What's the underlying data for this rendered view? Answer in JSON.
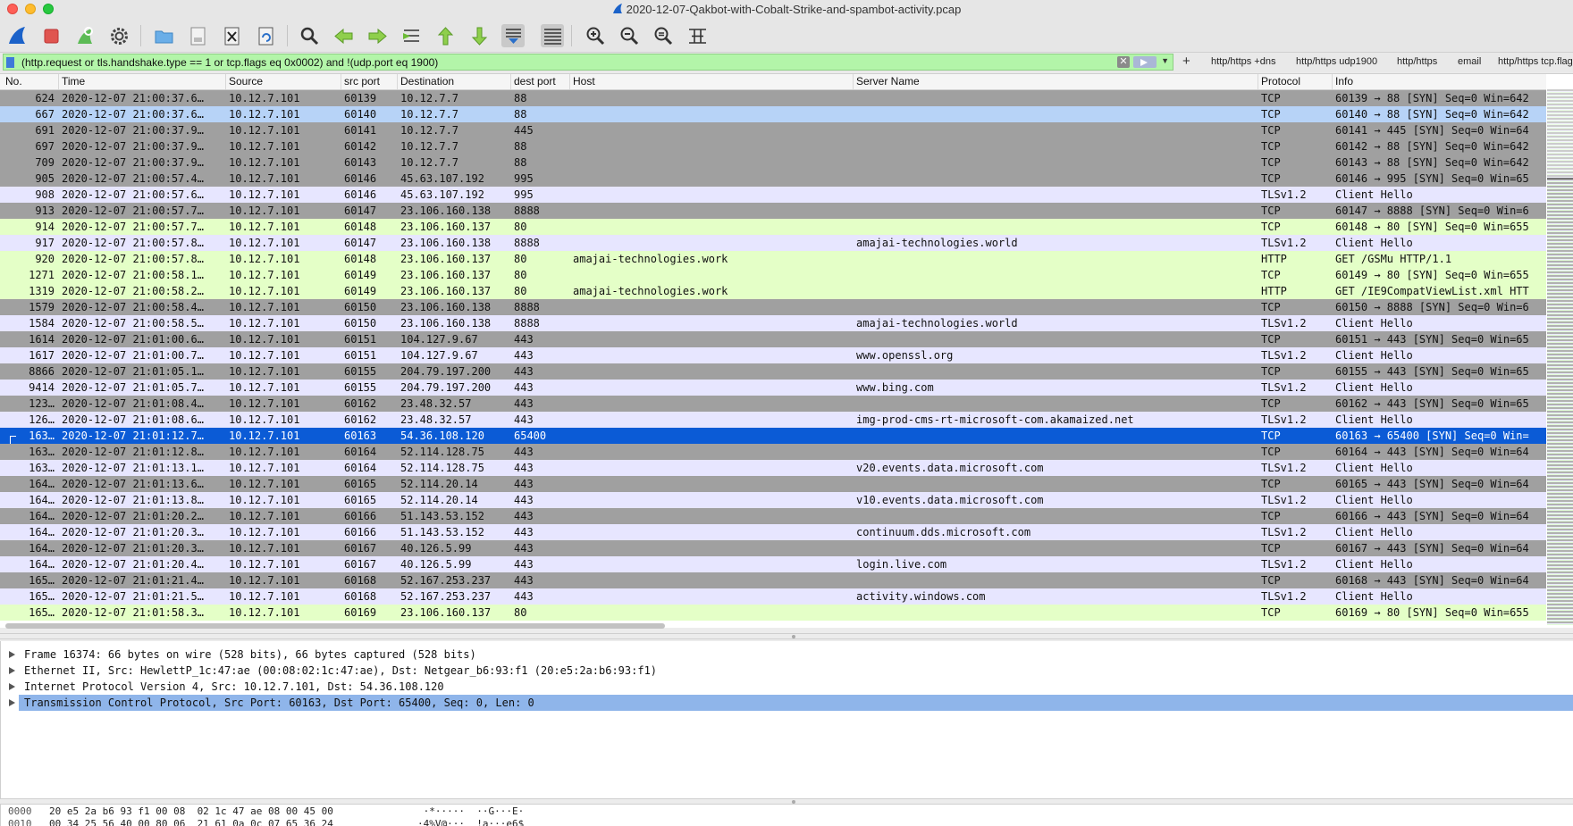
{
  "window": {
    "title": "2020-12-07-Qakbot-with-Cobalt-Strike-and-spambot-activity.pcap"
  },
  "toolbar": {
    "buttons": [
      {
        "icon": "shark-fin-start-icon"
      },
      {
        "icon": "stop-capture-icon"
      },
      {
        "icon": "restart-capture-icon"
      },
      {
        "icon": "capture-options-gear-icon"
      },
      {
        "icon": "open-folder-icon"
      },
      {
        "icon": "save-file-icon"
      },
      {
        "icon": "close-file-icon"
      },
      {
        "icon": "reload-file-icon"
      },
      {
        "icon": "find-packet-icon"
      },
      {
        "icon": "go-back-icon"
      },
      {
        "icon": "go-forward-icon"
      },
      {
        "icon": "go-to-packet-icon"
      },
      {
        "icon": "first-packet-icon"
      },
      {
        "icon": "last-packet-icon"
      },
      {
        "icon": "autoscroll-icon"
      },
      {
        "icon": "colorize-icon"
      },
      {
        "icon": "zoom-in-icon"
      },
      {
        "icon": "zoom-out-icon"
      },
      {
        "icon": "zoom-normal-icon"
      },
      {
        "icon": "resize-columns-icon"
      }
    ]
  },
  "filter": {
    "expression": "(http.request or tls.handshake.type == 1 or tcp.flags eq 0x0002) and !(udp.port eq 1900)",
    "clear_glyph": "✕",
    "dropdown_glyph": "▼",
    "add_label": "+",
    "buttons": [
      "http/https +dns",
      "http/https udp1900",
      "http/https",
      "email",
      "http/https tcp.flags"
    ]
  },
  "columns": [
    "No.",
    "Time",
    "Source",
    "src port",
    "Destination",
    "dest port",
    "Host",
    "Server Name",
    "Protocol",
    "Info"
  ],
  "packets": [
    {
      "no": "624",
      "time": "2020-12-07 21:00:37.6…",
      "src": "10.12.7.101",
      "sport": "60139",
      "dst": "10.12.7.7",
      "dport": "88",
      "host": "",
      "sni": "",
      "proto": "TCP",
      "info": "60139 → 88 [SYN] Seq=0 Win=642",
      "style": "syn"
    },
    {
      "no": "667",
      "time": "2020-12-07 21:00:37.6…",
      "src": "10.12.7.101",
      "sport": "60140",
      "dst": "10.12.7.7",
      "dport": "88",
      "host": "",
      "sni": "",
      "proto": "TCP",
      "info": "60140 → 88 [SYN] Seq=0 Win=642",
      "style": "blue"
    },
    {
      "no": "691",
      "time": "2020-12-07 21:00:37.9…",
      "src": "10.12.7.101",
      "sport": "60141",
      "dst": "10.12.7.7",
      "dport": "445",
      "host": "",
      "sni": "",
      "proto": "TCP",
      "info": "60141 → 445 [SYN] Seq=0 Win=64",
      "style": "syn"
    },
    {
      "no": "697",
      "time": "2020-12-07 21:00:37.9…",
      "src": "10.12.7.101",
      "sport": "60142",
      "dst": "10.12.7.7",
      "dport": "88",
      "host": "",
      "sni": "",
      "proto": "TCP",
      "info": "60142 → 88 [SYN] Seq=0 Win=642",
      "style": "syn"
    },
    {
      "no": "709",
      "time": "2020-12-07 21:00:37.9…",
      "src": "10.12.7.101",
      "sport": "60143",
      "dst": "10.12.7.7",
      "dport": "88",
      "host": "",
      "sni": "",
      "proto": "TCP",
      "info": "60143 → 88 [SYN] Seq=0 Win=642",
      "style": "syn"
    },
    {
      "no": "905",
      "time": "2020-12-07 21:00:57.4…",
      "src": "10.12.7.101",
      "sport": "60146",
      "dst": "45.63.107.192",
      "dport": "995",
      "host": "",
      "sni": "",
      "proto": "TCP",
      "info": "60146 → 995 [SYN] Seq=0 Win=65",
      "style": "syn"
    },
    {
      "no": "908",
      "time": "2020-12-07 21:00:57.6…",
      "src": "10.12.7.101",
      "sport": "60146",
      "dst": "45.63.107.192",
      "dport": "995",
      "host": "",
      "sni": "",
      "proto": "TLSv1.2",
      "info": "Client Hello",
      "style": "tls"
    },
    {
      "no": "913",
      "time": "2020-12-07 21:00:57.7…",
      "src": "10.12.7.101",
      "sport": "60147",
      "dst": "23.106.160.138",
      "dport": "8888",
      "host": "",
      "sni": "",
      "proto": "TCP",
      "info": "60147 → 8888 [SYN] Seq=0 Win=6",
      "style": "syn"
    },
    {
      "no": "914",
      "time": "2020-12-07 21:00:57.7…",
      "src": "10.12.7.101",
      "sport": "60148",
      "dst": "23.106.160.137",
      "dport": "80",
      "host": "",
      "sni": "",
      "proto": "TCP",
      "info": "60148 → 80 [SYN] Seq=0 Win=655",
      "style": "http"
    },
    {
      "no": "917",
      "time": "2020-12-07 21:00:57.8…",
      "src": "10.12.7.101",
      "sport": "60147",
      "dst": "23.106.160.138",
      "dport": "8888",
      "host": "",
      "sni": "amajai-technologies.world",
      "proto": "TLSv1.2",
      "info": "Client Hello",
      "style": "tls"
    },
    {
      "no": "920",
      "time": "2020-12-07 21:00:57.8…",
      "src": "10.12.7.101",
      "sport": "60148",
      "dst": "23.106.160.137",
      "dport": "80",
      "host": "amajai-technologies.work",
      "sni": "",
      "proto": "HTTP",
      "info": "GET /GSMu HTTP/1.1",
      "style": "http"
    },
    {
      "no": "1271",
      "time": "2020-12-07 21:00:58.1…",
      "src": "10.12.7.101",
      "sport": "60149",
      "dst": "23.106.160.137",
      "dport": "80",
      "host": "",
      "sni": "",
      "proto": "TCP",
      "info": "60149 → 80 [SYN] Seq=0 Win=655",
      "style": "http"
    },
    {
      "no": "1319",
      "time": "2020-12-07 21:00:58.2…",
      "src": "10.12.7.101",
      "sport": "60149",
      "dst": "23.106.160.137",
      "dport": "80",
      "host": "amajai-technologies.work",
      "sni": "",
      "proto": "HTTP",
      "info": "GET /IE9CompatViewList.xml HTT",
      "style": "http"
    },
    {
      "no": "1579",
      "time": "2020-12-07 21:00:58.4…",
      "src": "10.12.7.101",
      "sport": "60150",
      "dst": "23.106.160.138",
      "dport": "8888",
      "host": "",
      "sni": "",
      "proto": "TCP",
      "info": "60150 → 8888 [SYN] Seq=0 Win=6",
      "style": "syn"
    },
    {
      "no": "1584",
      "time": "2020-12-07 21:00:58.5…",
      "src": "10.12.7.101",
      "sport": "60150",
      "dst": "23.106.160.138",
      "dport": "8888",
      "host": "",
      "sni": "amajai-technologies.world",
      "proto": "TLSv1.2",
      "info": "Client Hello",
      "style": "tls"
    },
    {
      "no": "1614",
      "time": "2020-12-07 21:01:00.6…",
      "src": "10.12.7.101",
      "sport": "60151",
      "dst": "104.127.9.67",
      "dport": "443",
      "host": "",
      "sni": "",
      "proto": "TCP",
      "info": "60151 → 443 [SYN] Seq=0 Win=65",
      "style": "syn"
    },
    {
      "no": "1617",
      "time": "2020-12-07 21:01:00.7…",
      "src": "10.12.7.101",
      "sport": "60151",
      "dst": "104.127.9.67",
      "dport": "443",
      "host": "",
      "sni": "www.openssl.org",
      "proto": "TLSv1.2",
      "info": "Client Hello",
      "style": "tls"
    },
    {
      "no": "8866",
      "time": "2020-12-07 21:01:05.1…",
      "src": "10.12.7.101",
      "sport": "60155",
      "dst": "204.79.197.200",
      "dport": "443",
      "host": "",
      "sni": "",
      "proto": "TCP",
      "info": "60155 → 443 [SYN] Seq=0 Win=65",
      "style": "syn"
    },
    {
      "no": "9414",
      "time": "2020-12-07 21:01:05.7…",
      "src": "10.12.7.101",
      "sport": "60155",
      "dst": "204.79.197.200",
      "dport": "443",
      "host": "",
      "sni": "www.bing.com",
      "proto": "TLSv1.2",
      "info": "Client Hello",
      "style": "tls"
    },
    {
      "no": "123…",
      "time": "2020-12-07 21:01:08.4…",
      "src": "10.12.7.101",
      "sport": "60162",
      "dst": "23.48.32.57",
      "dport": "443",
      "host": "",
      "sni": "",
      "proto": "TCP",
      "info": "60162 → 443 [SYN] Seq=0 Win=65",
      "style": "syn"
    },
    {
      "no": "126…",
      "time": "2020-12-07 21:01:08.6…",
      "src": "10.12.7.101",
      "sport": "60162",
      "dst": "23.48.32.57",
      "dport": "443",
      "host": "",
      "sni": "img-prod-cms-rt-microsoft-com.akamaized.net",
      "proto": "TLSv1.2",
      "info": "Client Hello",
      "style": "tls"
    },
    {
      "no": "163…",
      "time": "2020-12-07 21:01:12.7…",
      "src": "10.12.7.101",
      "sport": "60163",
      "dst": "54.36.108.120",
      "dport": "65400",
      "host": "",
      "sni": "",
      "proto": "TCP",
      "info": "60163 → 65400 [SYN] Seq=0 Win=",
      "style": "selected"
    },
    {
      "no": "163…",
      "time": "2020-12-07 21:01:12.8…",
      "src": "10.12.7.101",
      "sport": "60164",
      "dst": "52.114.128.75",
      "dport": "443",
      "host": "",
      "sni": "",
      "proto": "TCP",
      "info": "60164 → 443 [SYN] Seq=0 Win=64",
      "style": "syn"
    },
    {
      "no": "163…",
      "time": "2020-12-07 21:01:13.1…",
      "src": "10.12.7.101",
      "sport": "60164",
      "dst": "52.114.128.75",
      "dport": "443",
      "host": "",
      "sni": "v20.events.data.microsoft.com",
      "proto": "TLSv1.2",
      "info": "Client Hello",
      "style": "tls"
    },
    {
      "no": "164…",
      "time": "2020-12-07 21:01:13.6…",
      "src": "10.12.7.101",
      "sport": "60165",
      "dst": "52.114.20.14",
      "dport": "443",
      "host": "",
      "sni": "",
      "proto": "TCP",
      "info": "60165 → 443 [SYN] Seq=0 Win=64",
      "style": "syn"
    },
    {
      "no": "164…",
      "time": "2020-12-07 21:01:13.8…",
      "src": "10.12.7.101",
      "sport": "60165",
      "dst": "52.114.20.14",
      "dport": "443",
      "host": "",
      "sni": "v10.events.data.microsoft.com",
      "proto": "TLSv1.2",
      "info": "Client Hello",
      "style": "tls"
    },
    {
      "no": "164…",
      "time": "2020-12-07 21:01:20.2…",
      "src": "10.12.7.101",
      "sport": "60166",
      "dst": "51.143.53.152",
      "dport": "443",
      "host": "",
      "sni": "",
      "proto": "TCP",
      "info": "60166 → 443 [SYN] Seq=0 Win=64",
      "style": "syn"
    },
    {
      "no": "164…",
      "time": "2020-12-07 21:01:20.3…",
      "src": "10.12.7.101",
      "sport": "60166",
      "dst": "51.143.53.152",
      "dport": "443",
      "host": "",
      "sni": "continuum.dds.microsoft.com",
      "proto": "TLSv1.2",
      "info": "Client Hello",
      "style": "tls"
    },
    {
      "no": "164…",
      "time": "2020-12-07 21:01:20.3…",
      "src": "10.12.7.101",
      "sport": "60167",
      "dst": "40.126.5.99",
      "dport": "443",
      "host": "",
      "sni": "",
      "proto": "TCP",
      "info": "60167 → 443 [SYN] Seq=0 Win=64",
      "style": "syn"
    },
    {
      "no": "164…",
      "time": "2020-12-07 21:01:20.4…",
      "src": "10.12.7.101",
      "sport": "60167",
      "dst": "40.126.5.99",
      "dport": "443",
      "host": "",
      "sni": "login.live.com",
      "proto": "TLSv1.2",
      "info": "Client Hello",
      "style": "tls"
    },
    {
      "no": "165…",
      "time": "2020-12-07 21:01:21.4…",
      "src": "10.12.7.101",
      "sport": "60168",
      "dst": "52.167.253.237",
      "dport": "443",
      "host": "",
      "sni": "",
      "proto": "TCP",
      "info": "60168 → 443 [SYN] Seq=0 Win=64",
      "style": "syn"
    },
    {
      "no": "165…",
      "time": "2020-12-07 21:01:21.5…",
      "src": "10.12.7.101",
      "sport": "60168",
      "dst": "52.167.253.237",
      "dport": "443",
      "host": "",
      "sni": "activity.windows.com",
      "proto": "TLSv1.2",
      "info": "Client Hello",
      "style": "tls"
    },
    {
      "no": "165…",
      "time": "2020-12-07 21:01:58.3…",
      "src": "10.12.7.101",
      "sport": "60169",
      "dst": "23.106.160.137",
      "dport": "80",
      "host": "",
      "sni": "",
      "proto": "TCP",
      "info": "60169 → 80 [SYN] Seq=0 Win=655",
      "style": "http"
    }
  ],
  "row_colors": {
    "syn": {
      "bg": "#a0a0a0",
      "fg": "#111111"
    },
    "tls": {
      "bg": "#e7e6ff",
      "fg": "#111111"
    },
    "http": {
      "bg": "#e4ffc7",
      "fg": "#111111"
    },
    "blue": {
      "bg": "#b7d3f7",
      "fg": "#111111"
    },
    "selected": {
      "bg": "#0b5bd6",
      "fg": "#ffffff"
    }
  },
  "details": [
    {
      "text": "Frame 16374: 66 bytes on wire (528 bits), 66 bytes captured (528 bits)",
      "selected": false
    },
    {
      "text": "Ethernet II, Src: HewlettP_1c:47:ae (00:08:02:1c:47:ae), Dst: Netgear_b6:93:f1 (20:e5:2a:b6:93:f1)",
      "selected": false
    },
    {
      "text": "Internet Protocol Version 4, Src: 10.12.7.101, Dst: 54.36.108.120",
      "selected": false
    },
    {
      "text": "Transmission Control Protocol, Src Port: 60163, Dst Port: 65400, Seq: 0, Len: 0",
      "selected": true
    }
  ],
  "bytes": [
    {
      "offset": "0000",
      "hex": "20 e5 2a b6 93 f1 00 08  02 1c 47 ae 08 00 45 00",
      "ascii": " ·*·····  ··G···E·"
    },
    {
      "offset": "0010",
      "hex": "00 34 25 56 40 00 80 06  21 61 0a 0c 07 65 36 24",
      "ascii": "·4%V@···  !a···e6$"
    }
  ]
}
